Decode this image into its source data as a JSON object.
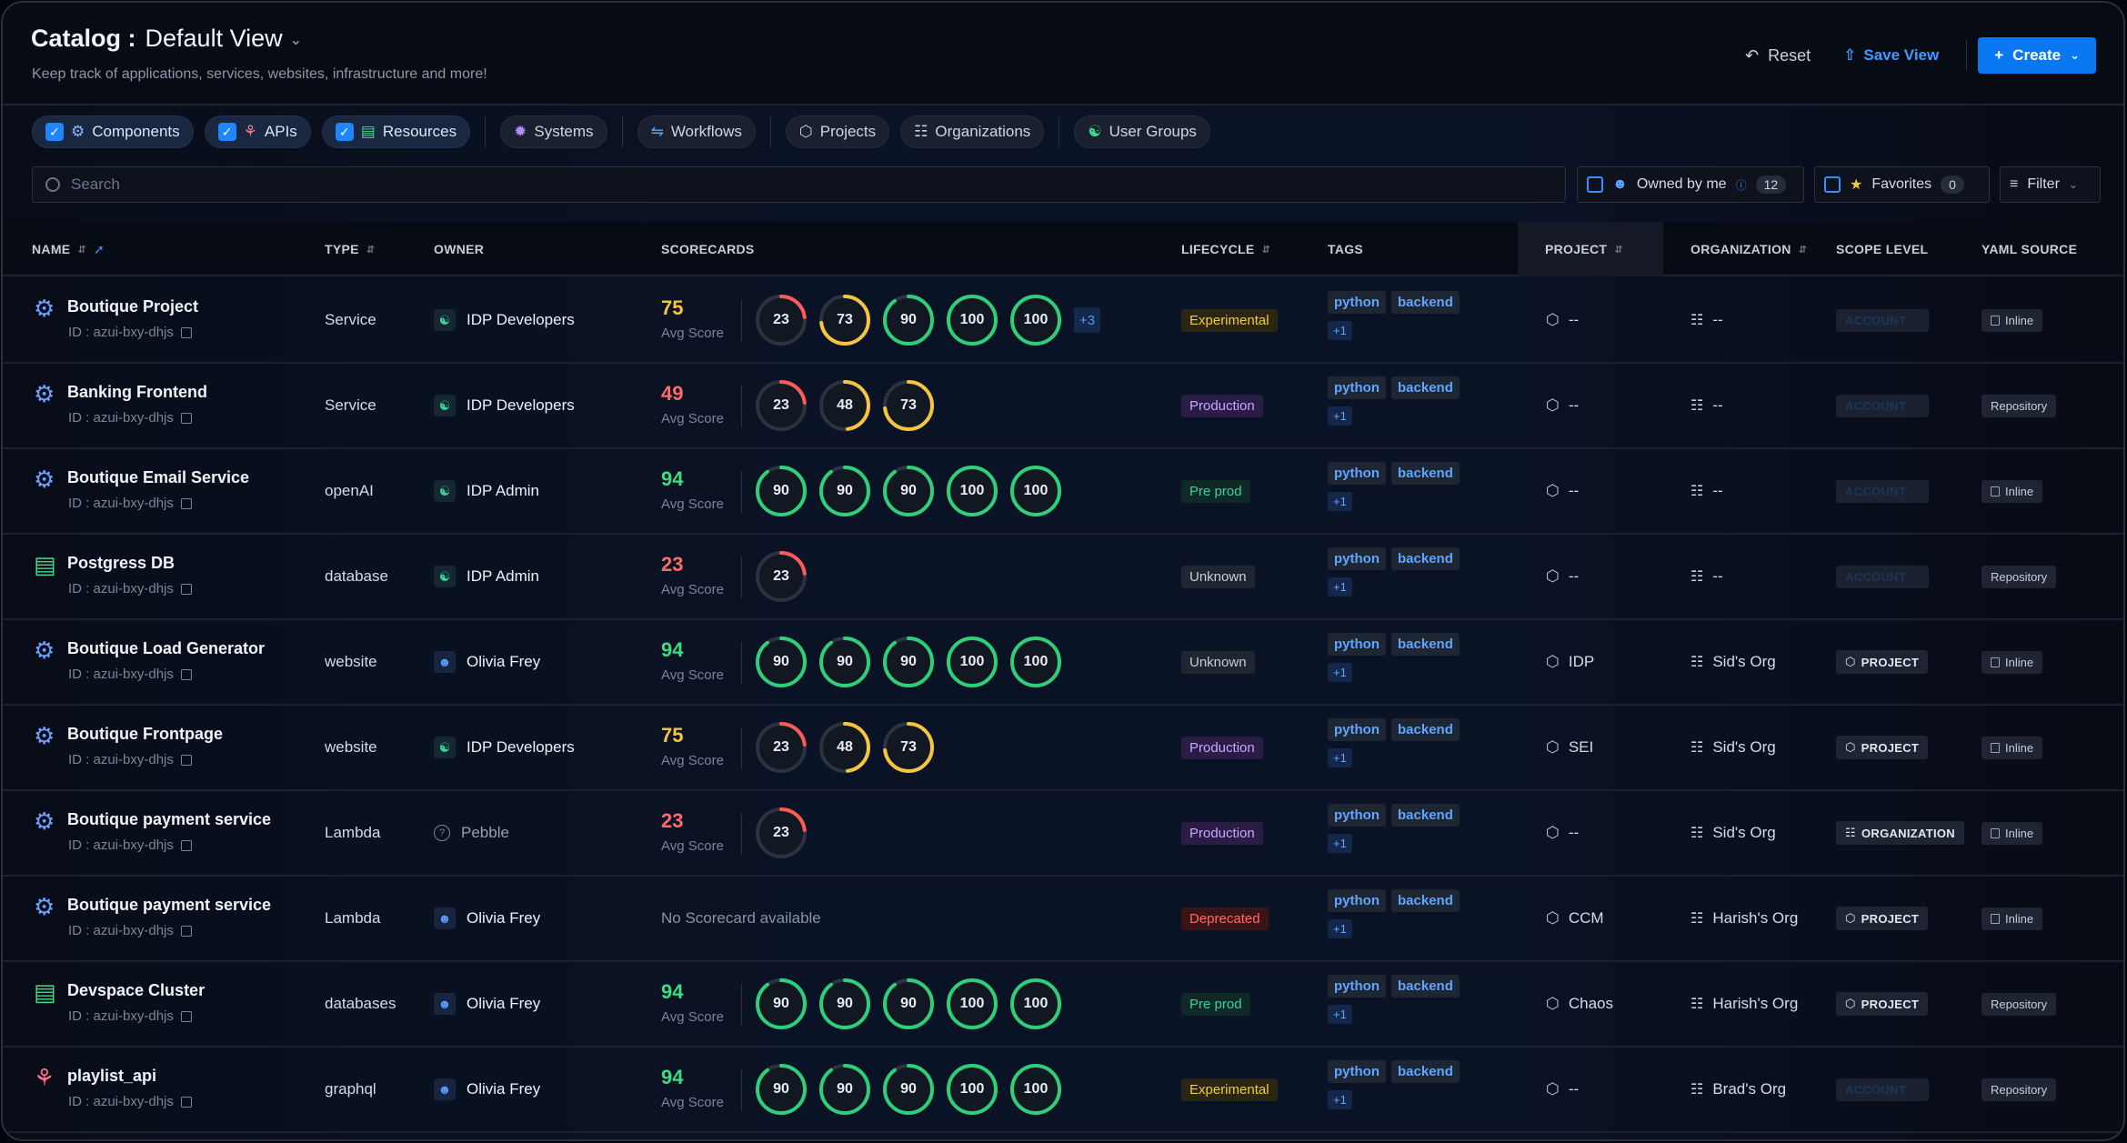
{
  "header": {
    "title": "Catalog :",
    "view_name": "Default View",
    "subtitle": "Keep track of applications, services, websites, infrastructure and more!",
    "reset_label": "Reset",
    "save_view_label": "Save View",
    "create_label": "Create"
  },
  "chips": [
    {
      "label": "Components",
      "checked": true
    },
    {
      "label": "APIs",
      "checked": true
    },
    {
      "label": "Resources",
      "checked": true
    },
    {
      "label": "Systems",
      "checked": false
    },
    {
      "label": "Workflows",
      "checked": false
    },
    {
      "label": "Projects",
      "checked": false
    },
    {
      "label": "Organizations",
      "checked": false
    },
    {
      "label": "User Groups",
      "checked": false
    }
  ],
  "search": {
    "placeholder": "Search"
  },
  "filters": {
    "owned_by_me_label": "Owned by me",
    "owned_by_me_count": "12",
    "favorites_label": "Favorites",
    "favorites_count": "0",
    "filter_label": "Filter"
  },
  "columns": {
    "name": "NAME",
    "type": "TYPE",
    "owner": "OWNER",
    "scorecards": "SCORECARDS",
    "lifecycle": "LIFECYCLE",
    "tags": "TAGS",
    "project": "PROJECT",
    "organization": "ORGANIZATION",
    "scope_level": "SCOPE LEVEL",
    "yaml_source": "YAML SOURCE"
  },
  "avg_score_label": "Avg Score",
  "no_scorecard_label": "No Scorecard available",
  "rows": [
    {
      "name": "Boutique Project",
      "id": "ID : azui-bxy-dhjs",
      "kind": "component",
      "type": "Service",
      "owner": "IDP Developers",
      "owner_kind": "group",
      "avg": "75",
      "avg_color": "#f5c542",
      "scores": [
        23,
        73,
        90,
        100,
        100
      ],
      "more": "+3",
      "lifecycle": "Experimental",
      "tags": [
        "python",
        "backend",
        "+1"
      ],
      "project": "--",
      "org": "--",
      "scope": "ACCOUNT",
      "scope_ghost": true,
      "yaml": "Inline"
    },
    {
      "name": "Banking Frontend",
      "id": "ID : azui-bxy-dhjs",
      "kind": "component",
      "type": "Service",
      "owner": "IDP Developers",
      "owner_kind": "group",
      "avg": "49",
      "avg_color": "#ff6b6b",
      "scores": [
        23,
        48,
        73
      ],
      "more": "",
      "lifecycle": "Production",
      "tags": [
        "python",
        "backend",
        "+1"
      ],
      "project": "--",
      "org": "--",
      "scope": "ACCOUNT",
      "scope_ghost": true,
      "yaml": "Repository"
    },
    {
      "name": "Boutique Email Service",
      "id": "ID : azui-bxy-dhjs",
      "kind": "component",
      "type": "openAI",
      "owner": "IDP Admin",
      "owner_kind": "group",
      "avg": "94",
      "avg_color": "#3ddc84",
      "scores": [
        90,
        90,
        90,
        100,
        100
      ],
      "more": "",
      "lifecycle": "Pre prod",
      "tags": [
        "python",
        "backend",
        "+1"
      ],
      "project": "--",
      "org": "--",
      "scope": "ACCOUNT",
      "scope_ghost": true,
      "yaml": "Inline"
    },
    {
      "name": "Postgress DB",
      "id": "ID : azui-bxy-dhjs",
      "kind": "resource",
      "type": "database",
      "owner": "IDP Admin",
      "owner_kind": "group",
      "avg": "23",
      "avg_color": "#ff6b6b",
      "scores": [
        23
      ],
      "more": "",
      "lifecycle": "Unknown",
      "tags": [
        "python",
        "backend",
        "+1"
      ],
      "project": "--",
      "org": "--",
      "scope": "ACCOUNT",
      "scope_ghost": true,
      "yaml": "Repository"
    },
    {
      "name": "Boutique Load Generator",
      "id": "ID : azui-bxy-dhjs",
      "kind": "component",
      "type": "website",
      "owner": "Olivia Frey",
      "owner_kind": "user",
      "avg": "94",
      "avg_color": "#3ddc84",
      "scores": [
        90,
        90,
        90,
        100,
        100
      ],
      "more": "",
      "lifecycle": "Unknown",
      "tags": [
        "python",
        "backend",
        "+1"
      ],
      "project": "IDP",
      "org": "Sid's Org",
      "scope": "PROJECT",
      "scope_ghost": false,
      "yaml": "Inline"
    },
    {
      "name": "Boutique Frontpage",
      "id": "ID : azui-bxy-dhjs",
      "kind": "component",
      "type": "website",
      "owner": "IDP Developers",
      "owner_kind": "group",
      "avg": "75",
      "avg_color": "#f5c542",
      "scores": [
        23,
        48,
        73
      ],
      "more": "",
      "lifecycle": "Production",
      "tags": [
        "python",
        "backend",
        "+1"
      ],
      "project": "SEI",
      "org": "Sid's Org",
      "scope": "PROJECT",
      "scope_ghost": false,
      "yaml": "Inline"
    },
    {
      "name": "Boutique payment service",
      "id": "ID : azui-bxy-dhjs",
      "kind": "component",
      "type": "Lambda",
      "owner": "Pebble",
      "owner_kind": "unknown",
      "avg": "23",
      "avg_color": "#ff6b6b",
      "scores": [
        23
      ],
      "more": "",
      "lifecycle": "Production",
      "tags": [
        "python",
        "backend",
        "+1"
      ],
      "project": "--",
      "org": "Sid's Org",
      "scope": "ORGANIZATION",
      "scope_ghost": false,
      "yaml": "Inline"
    },
    {
      "name": "Boutique payment service",
      "id": "ID : azui-bxy-dhjs",
      "kind": "component",
      "type": "Lambda",
      "owner": "Olivia Frey",
      "owner_kind": "user",
      "avg": "",
      "avg_color": "",
      "scores": [],
      "more": "",
      "lifecycle": "Deprecated",
      "tags": [
        "python",
        "backend",
        "+1"
      ],
      "project": "CCM",
      "org": "Harish's Org",
      "scope": "PROJECT",
      "scope_ghost": false,
      "yaml": "Inline"
    },
    {
      "name": "Devspace Cluster",
      "id": "ID : azui-bxy-dhjs",
      "kind": "resource",
      "type": "databases",
      "owner": "Olivia Frey",
      "owner_kind": "user",
      "avg": "94",
      "avg_color": "#3ddc84",
      "scores": [
        90,
        90,
        90,
        100,
        100
      ],
      "more": "",
      "lifecycle": "Pre prod",
      "tags": [
        "python",
        "backend",
        "+1"
      ],
      "project": "Chaos",
      "org": "Harish's Org",
      "scope": "PROJECT",
      "scope_ghost": false,
      "yaml": "Repository"
    },
    {
      "name": "playlist_api",
      "id": "ID : azui-bxy-dhjs",
      "kind": "api",
      "type": "graphql",
      "owner": "Olivia Frey",
      "owner_kind": "user",
      "avg": "94",
      "avg_color": "#3ddc84",
      "scores": [
        90,
        90,
        90,
        100,
        100
      ],
      "more": "",
      "lifecycle": "Experimental",
      "tags": [
        "python",
        "backend",
        "+1"
      ],
      "project": "--",
      "org": "Brad's Org",
      "scope": "ACCOUNT",
      "scope_ghost": true,
      "yaml": "Repository"
    }
  ],
  "colors": {
    "accent": "#0a78f0",
    "score_low": "#ff5a5a",
    "score_mid": "#f5c542",
    "score_high": "#2fcf7a"
  },
  "icons": {
    "component": "gear-icon",
    "resource": "server-icon",
    "api": "webhook-icon"
  }
}
